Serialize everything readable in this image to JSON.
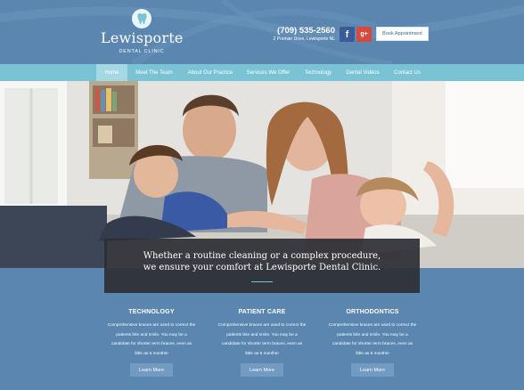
{
  "brand": {
    "name": "Lewisporte",
    "subtitle": "DENTAL CLINIC",
    "phone": "(709) 535-2560",
    "address": "2 Premier Drive, Lewisporte NL",
    "book_label": "Book Appointment",
    "facebook_glyph": "f",
    "googleplus_glyph": "g+"
  },
  "nav": {
    "items": [
      {
        "label": "Home",
        "active": true
      },
      {
        "label": "Meet The Team"
      },
      {
        "label": "About Our Practice"
      },
      {
        "label": "Services We Offer"
      },
      {
        "label": "Technology"
      },
      {
        "label": "Dental Videos"
      },
      {
        "label": "Contact Us"
      }
    ]
  },
  "hero": {
    "caption_line1": "Whether a routine cleaning or a complex procedure,",
    "caption_line2": "we ensure your comfort at Lewisporte Dental Clinic."
  },
  "features": [
    {
      "title": "TECHNOLOGY",
      "lines": [
        "Comprehensive braces are used to correct the",
        "patients bite and smile. You may be a",
        "candidate for shorter term braces, even as",
        "little as 6 months!"
      ],
      "button": "Learn More"
    },
    {
      "title": "PATIENT CARE",
      "lines": [
        "Comprehensive braces are used to correct the",
        "patients bite and smile. You may be a",
        "candidate for shorter term braces, even as",
        "little as 6 months!"
      ],
      "button": "Learn More"
    },
    {
      "title": "ORTHODONTICS",
      "lines": [
        "Comprehensive braces are used to correct the",
        "patients bite and smile. You may be a",
        "candidate for shorter term braces, even as",
        "little as 6 months!"
      ],
      "button": "Learn More"
    }
  ],
  "colors": {
    "background": "#5a86b0",
    "nav": "#79c3d4",
    "nav_active": "#a4d8e3",
    "caption_bg": "#2d2f34",
    "button": "#739ac0",
    "facebook": "#3b5a9a",
    "googleplus": "#d8483b"
  }
}
